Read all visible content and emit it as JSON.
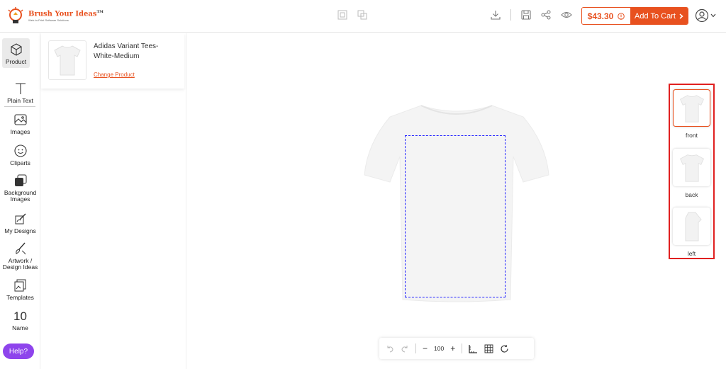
{
  "header": {
    "logo_title": "Brush Your Ideas",
    "logo_tm": "TM",
    "logo_tagline": "Web-to-Print Software Solutions",
    "price": "$43.30",
    "add_to_cart": "Add To Cart",
    "icons": [
      "copy-layer-icon",
      "duplicate-icon",
      "download-icon",
      "save-icon",
      "share-icon",
      "preview-icon",
      "info-icon",
      "chevron-right-icon",
      "user-icon",
      "chevron-down-icon"
    ]
  },
  "sidebar": {
    "items": [
      {
        "label": "Product",
        "icon": "cube-icon"
      },
      {
        "label": "Plain Text",
        "icon": "text-icon"
      },
      {
        "label": "Images",
        "icon": "image-icon"
      },
      {
        "label": "Cliparts",
        "icon": "smiley-icon"
      },
      {
        "label": "Background Images",
        "icon": "layers-icon"
      },
      {
        "label": "My Designs",
        "icon": "my-designs-icon"
      },
      {
        "label": "Artwork / Design Ideas",
        "icon": "brush-icon"
      },
      {
        "label": "Templates",
        "icon": "templates-icon"
      },
      {
        "label": "Name",
        "icon_text": "10"
      }
    ],
    "help": "Help?"
  },
  "panel": {
    "product_name": "Adidas Variant Tees-White-Medium",
    "change_product": "Change Product"
  },
  "canvas": {
    "views": [
      {
        "label": "front",
        "active": true
      },
      {
        "label": "back",
        "active": false
      },
      {
        "label": "left",
        "active": false
      }
    ],
    "zoom": "100",
    "zoom_icons": [
      "undo-icon",
      "redo-icon",
      "zoom-out-icon",
      "zoom-in-icon",
      "ruler-icon",
      "grid-icon",
      "reset-icon"
    ]
  },
  "colors": {
    "accent": "#e8511f",
    "help": "#8e44ec",
    "view_highlight": "#e02020",
    "print_area": "#2222ff"
  }
}
